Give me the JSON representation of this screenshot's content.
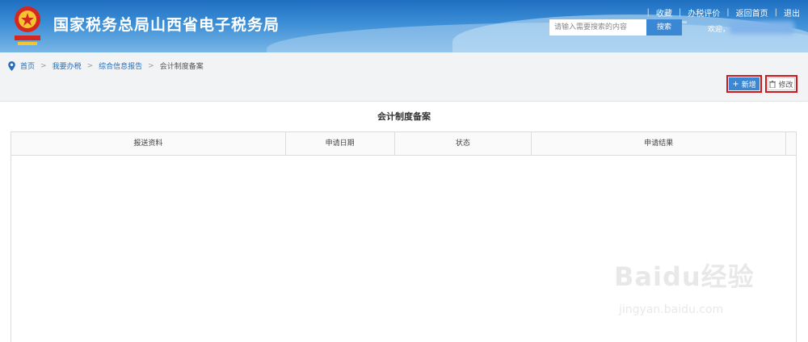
{
  "header": {
    "site_title": "国家税务总局山西省电子税务局",
    "links": [
      "收藏",
      "办税评价",
      "返回首页",
      "退出"
    ],
    "search_placeholder": "请输入需要搜索的内容",
    "search_button": "搜索",
    "welcome": "欢迎，",
    "brand_color": "#2a7ed0"
  },
  "breadcrumb": {
    "items": [
      "首页",
      "我要办税",
      "综合信息报告"
    ],
    "current": "会计制度备案",
    "separator": ">"
  },
  "toolbar": {
    "add_label": "新增",
    "edit_label": "修改",
    "add_icon": "plus-icon",
    "edit_icon": "trash-icon",
    "highlight_color": "#d0171e"
  },
  "panel": {
    "title": "会计制度备案",
    "columns": [
      "报送资料",
      "申请日期",
      "状态",
      "申请结果"
    ],
    "rows": []
  },
  "watermark": {
    "text": "Baidu经验",
    "sub": "jingyan.baidu.com"
  }
}
